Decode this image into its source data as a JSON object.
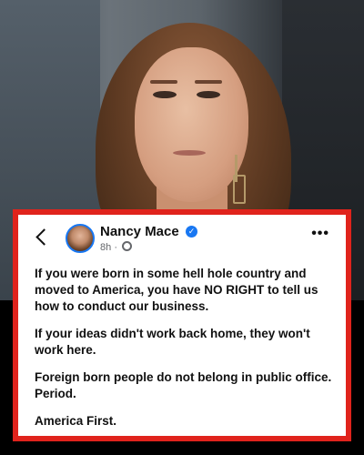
{
  "post": {
    "author": "Nancy Mace",
    "time": "8h",
    "separator": "·",
    "paragraphs": [
      "If you were born in some hell hole country and moved to America, you have NO RIGHT to tell us how to conduct our business.",
      "If your ideas didn't work back home, they won't work here.",
      "Foreign born people do not belong in public office. Period.",
      "America First."
    ]
  },
  "icons": {
    "back": "back-arrow-icon",
    "verified": "verified-badge-icon",
    "audience": "public-audience-icon",
    "more": "more-options-icon"
  },
  "colors": {
    "card_border": "#e0231c",
    "verified": "#1877f2",
    "meta_text": "#65676b"
  }
}
